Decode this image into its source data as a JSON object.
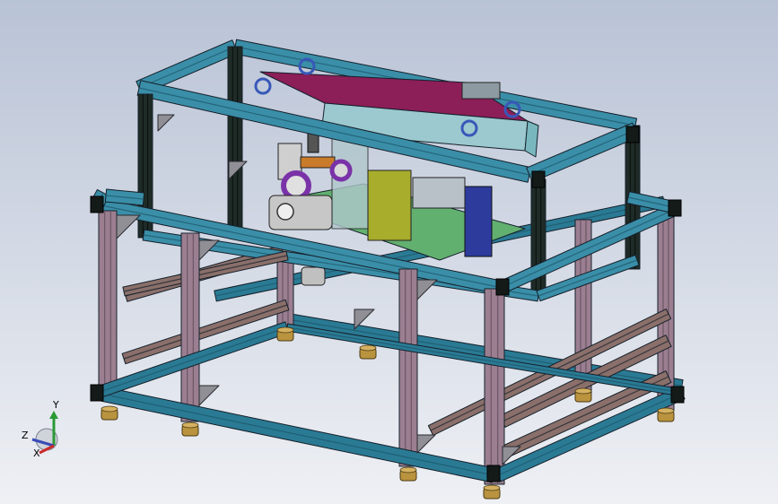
{
  "viewport": {
    "background_top": "#b9c3d6",
    "background_bottom": "#eef0f4"
  },
  "model": {
    "colors": {
      "lower_frame_profile": "#9b7f91",
      "lower_frame_profile_dark": "#6c5665",
      "base_rail": "#2a7a94",
      "base_rail_dark": "#1c5567",
      "upper_frame_profile": "#3a8ea8",
      "upper_frame_post": "#1f2b27",
      "feet": "#b9933e",
      "crossbeam": "#8a6f6a",
      "top_box": "#8c1e58",
      "box_side": "#78b7bd",
      "mounting_plate": "#62b070",
      "yellow_block": "#a8ad2c",
      "blue_block": "#2d3b9c",
      "purple_gear": "#7a32a8",
      "lifting_eye": "#3858b8"
    }
  },
  "triad": {
    "y_label": "Y",
    "z_label": "Z",
    "x_label": "X",
    "y_color": "#2a9a35",
    "z_color": "#3a4ab8",
    "x_color": "#cc2a2a"
  }
}
